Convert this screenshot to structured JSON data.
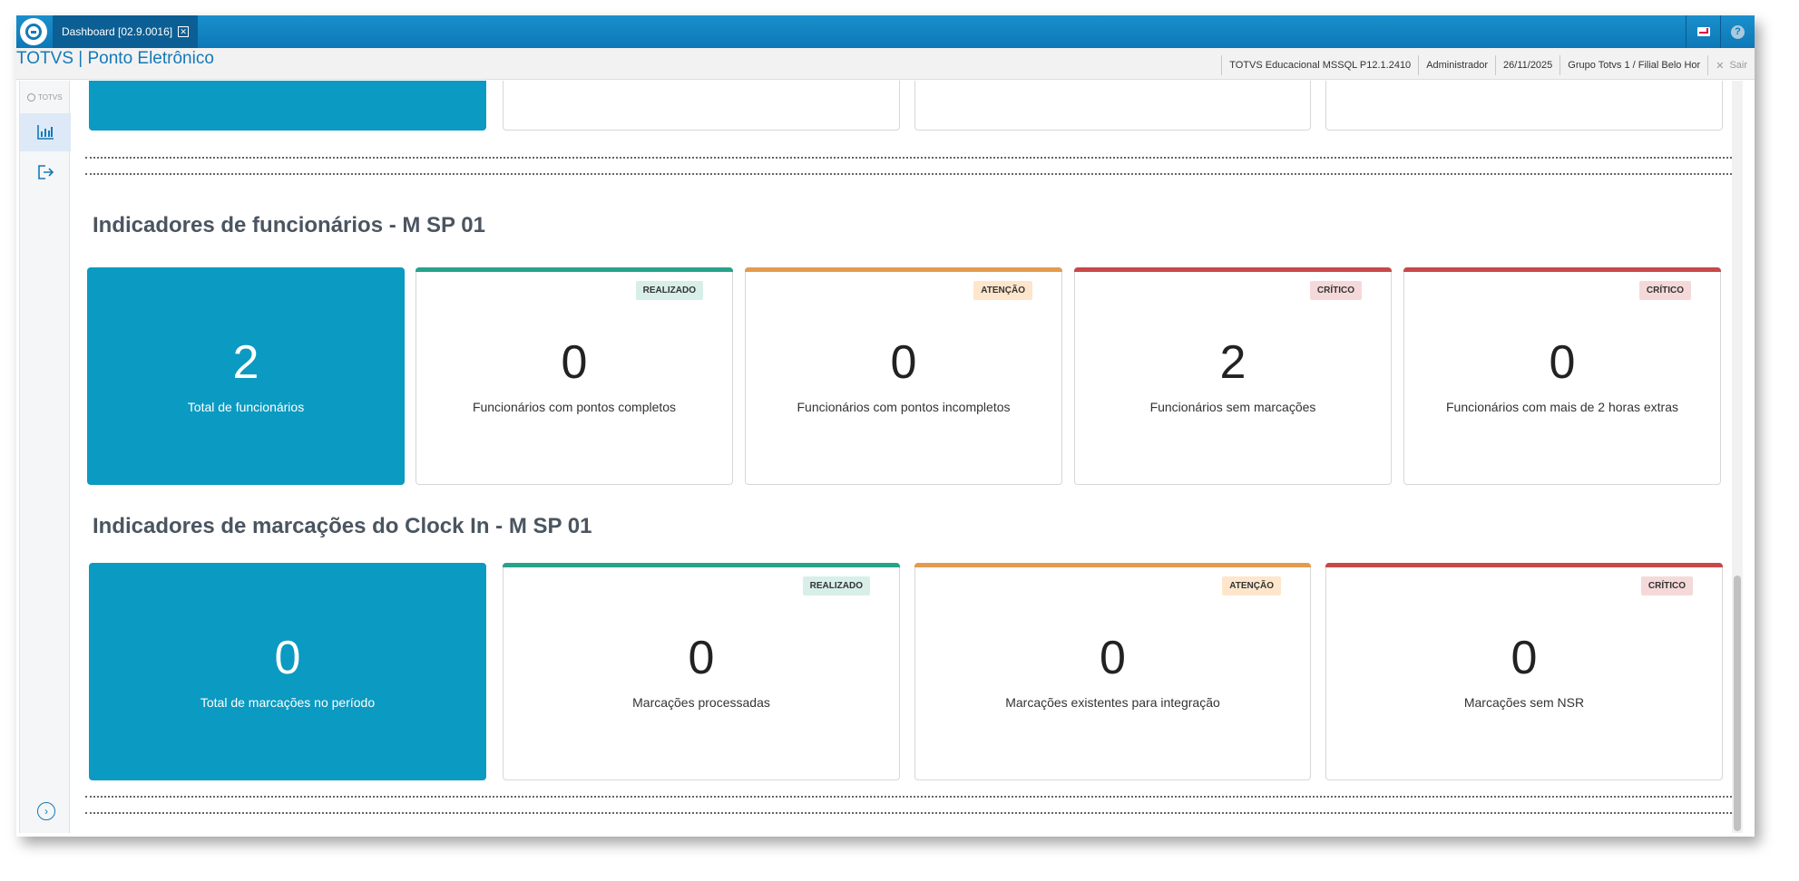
{
  "window": {
    "tab_label": "Dashboard [02.9.0016]",
    "app_title": "TOTVS | Ponto Eletrônico"
  },
  "status_bar": {
    "database": "TOTVS Educacional MSSQL P12.1.2410",
    "user": "Administrador",
    "date": "26/11/2025",
    "branch": "Grupo Totvs 1 / Filial Belo Hor",
    "exit_label": "Sair"
  },
  "sidebar": {
    "brand": "TOTVS",
    "items": [
      {
        "icon": "bar-chart-icon",
        "active": true
      },
      {
        "icon": "logout-icon",
        "active": false
      }
    ]
  },
  "sections": {
    "employees": {
      "title": "Indicadores de funcionários - M SP 01",
      "cards": [
        {
          "value": "2",
          "label": "Total de funcionários",
          "status": "primary",
          "badge": ""
        },
        {
          "value": "0",
          "label": "Funcionários com pontos completos",
          "status": "ok",
          "badge": "REALIZADO"
        },
        {
          "value": "0",
          "label": "Funcionários com pontos incompletos",
          "status": "warn",
          "badge": "ATENÇÃO"
        },
        {
          "value": "2",
          "label": "Funcionários sem marcações",
          "status": "crit",
          "badge": "CRÍTICO"
        },
        {
          "value": "0",
          "label": "Funcionários com mais de 2 horas extras",
          "status": "crit",
          "badge": "CRÍTICO"
        }
      ]
    },
    "clockin": {
      "title": "Indicadores de marcações do Clock In - M SP 01",
      "cards": [
        {
          "value": "0",
          "label": "Total de marcações no período",
          "status": "primary",
          "badge": ""
        },
        {
          "value": "0",
          "label": "Marcações processadas",
          "status": "ok",
          "badge": "REALIZADO"
        },
        {
          "value": "0",
          "label": "Marcações existentes para integração",
          "status": "warn",
          "badge": "ATENÇÃO"
        },
        {
          "value": "0",
          "label": "Marcações sem NSR",
          "status": "crit",
          "badge": "CRÍTICO"
        }
      ]
    }
  },
  "colors": {
    "primary": "#0b9ac1",
    "ok": "#27a38a",
    "warn": "#e39c4f",
    "crit": "#c8484a",
    "brand": "#1479b8"
  }
}
